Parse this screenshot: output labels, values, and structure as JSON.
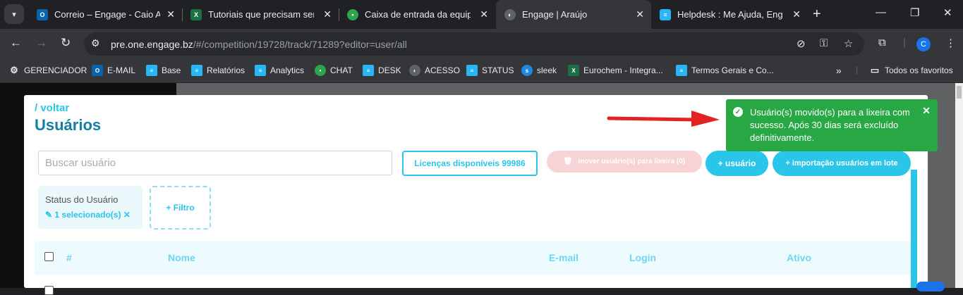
{
  "browser": {
    "tabs": [
      {
        "title": "Correio – Engage - Caio Araú",
        "icon": "outlook-icon",
        "color": "#0a64ad",
        "glyph": "O"
      },
      {
        "title": "Tutoriais que precisam ser cri",
        "icon": "excel-icon",
        "color": "#1d7044",
        "glyph": "X"
      },
      {
        "title": "Caixa de entrada da equipe",
        "icon": "chat-icon",
        "color": "#2da44e",
        "glyph": "•"
      },
      {
        "title": "Engage | Araújo",
        "icon": "globe-icon",
        "color": "#5f6368",
        "glyph": "◐",
        "active": true
      },
      {
        "title": "Helpdesk : Me Ajuda, Engage",
        "icon": "helpdesk-icon",
        "color": "#29b6f6",
        "glyph": "≡"
      }
    ],
    "url_host": "pre.one.engage.bz",
    "url_path": "/#/competition/19728/track/71289?editor=user/all",
    "profile_initial": "C",
    "bookmarks": [
      {
        "label": "GERENCIADOR",
        "icon": "gear-bookmark-icon",
        "color": "#5f6368",
        "glyph": "⚙"
      },
      {
        "label": "E-MAIL",
        "icon": "outlook-icon",
        "color": "#0a64ad",
        "glyph": "O"
      },
      {
        "label": "Base",
        "icon": "engage-icon",
        "color": "#29b6f6",
        "glyph": "≡"
      },
      {
        "label": "Relatórios",
        "icon": "engage-icon",
        "color": "#29b6f6",
        "glyph": "≡"
      },
      {
        "label": "Analytics",
        "icon": "engage-icon",
        "color": "#29b6f6",
        "glyph": "≡"
      },
      {
        "label": "CHAT",
        "icon": "chat-icon",
        "color": "#2da44e",
        "glyph": "•"
      },
      {
        "label": "DESK",
        "icon": "engage-icon",
        "color": "#29b6f6",
        "glyph": "≡"
      },
      {
        "label": "ACESSO",
        "icon": "globe-icon",
        "color": "#5f6368",
        "glyph": "◐"
      },
      {
        "label": "STATUS",
        "icon": "engage-icon",
        "color": "#29b6f6",
        "glyph": "≡"
      },
      {
        "label": "sleek",
        "icon": "sleek-icon",
        "color": "#1e88e5",
        "glyph": "s"
      },
      {
        "label": "Eurochem - Integra...",
        "icon": "excel-icon",
        "color": "#1d7044",
        "glyph": "X"
      },
      {
        "label": "Termos Gerais e Co...",
        "icon": "engage-icon",
        "color": "#29b6f6",
        "glyph": "≡"
      }
    ],
    "all_bookmarks": "Todos os favoritos"
  },
  "page": {
    "back_link": "/ voltar",
    "title": "Usuários",
    "search_placeholder": "Buscar usuário",
    "licenses_button": "Licenças disponíveis 99986",
    "trash_button": "mover usuário(s) para lixeira (0)",
    "add_user_button": "+ usuário",
    "import_button": "+ importação usuários em lote",
    "filter": {
      "label": "Status do Usuário",
      "value": "1 selecionado(s)"
    },
    "add_filter_button": "+ Filtro",
    "table_headers": [
      "#",
      "Nome",
      "E-mail",
      "Login",
      "Ativo"
    ]
  },
  "toast": {
    "message": "Usuário(s) movido(s) para a lixeira com sucesso. Após 30 dias será excluído definitivamente.",
    "color": "#28a745"
  },
  "accent_color": "#29c6ea"
}
